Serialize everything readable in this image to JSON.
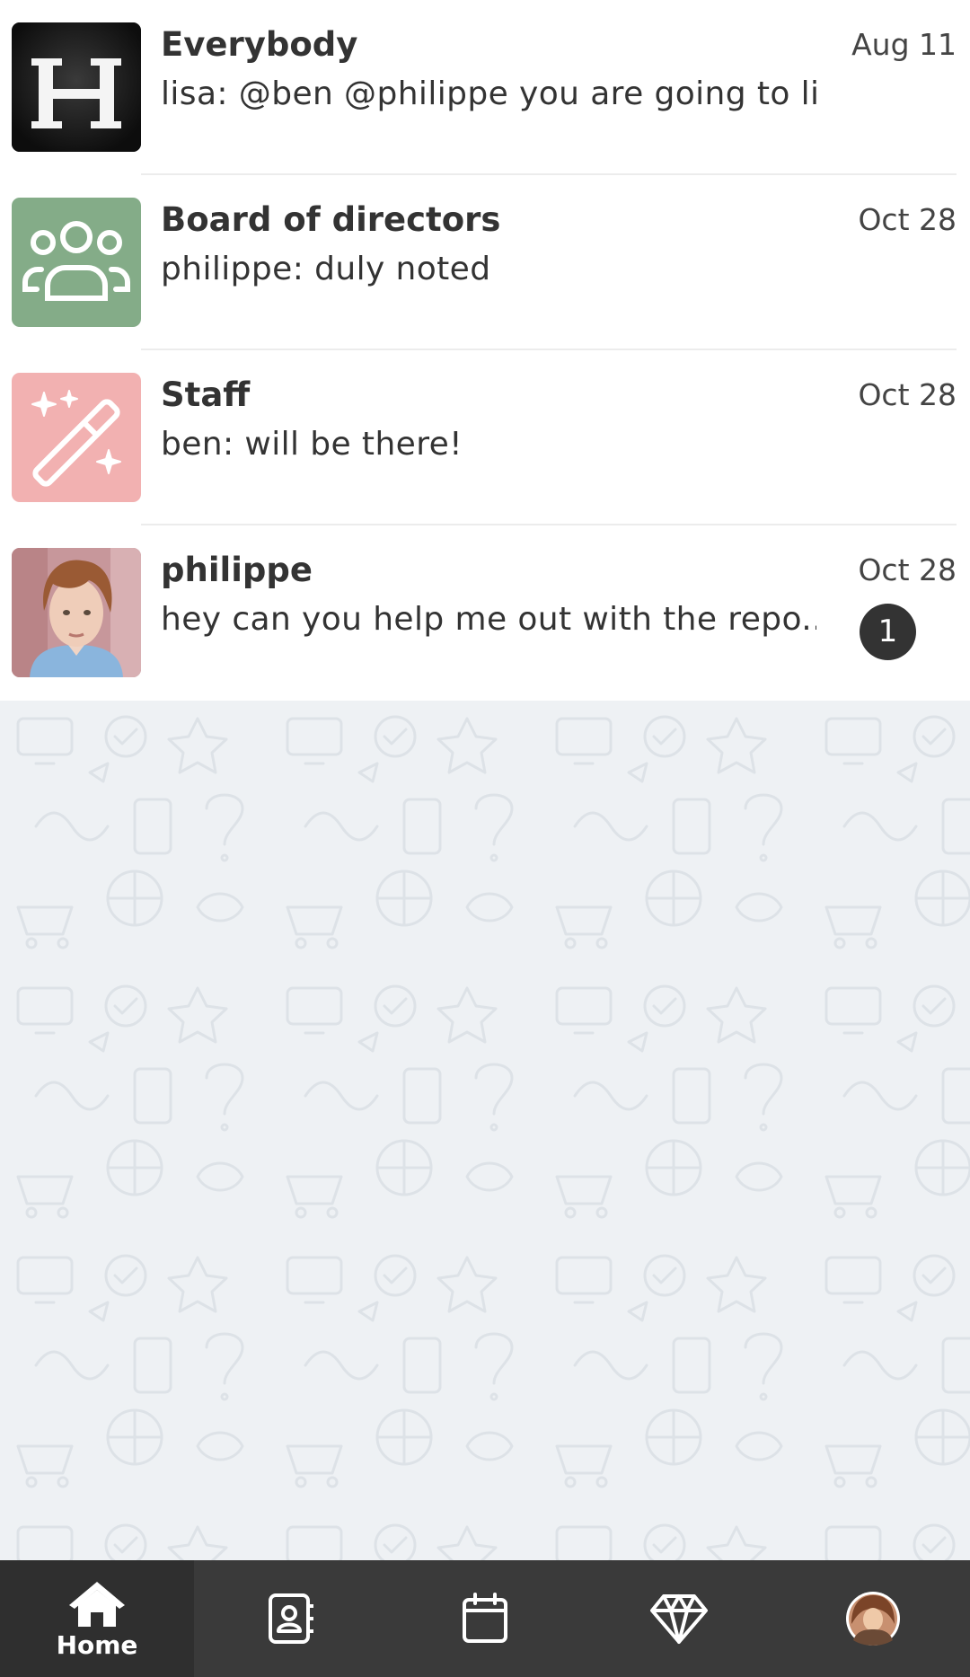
{
  "conversations": [
    {
      "name": "Everybody",
      "preview": "lisa: @ben @philippe you are going to li...",
      "date": "Aug 11",
      "avatar_icon": "h-logo-icon"
    },
    {
      "name": "Board of directors",
      "preview": "philippe: duly noted",
      "date": "Oct 28",
      "avatar_icon": "group-icon"
    },
    {
      "name": "Staff",
      "preview": "ben: will be there!",
      "date": "Oct 28",
      "avatar_icon": "magic-wand-icon"
    },
    {
      "name": "philippe",
      "preview": "hey can you help me out with the repo...",
      "date": "Oct 28",
      "avatar_icon": "user-photo",
      "unread": "1"
    }
  ],
  "tabbar": {
    "home_label": "Home",
    "icons": [
      "home-icon",
      "contacts-icon",
      "calendar-icon",
      "diamond-icon",
      "profile-avatar"
    ]
  },
  "colors": {
    "tabbar_bg": "#3a3a3a",
    "board_avatar": "#84ac88",
    "staff_avatar": "#f2b1b1",
    "badge": "#333333",
    "background": "#eef1f4"
  }
}
